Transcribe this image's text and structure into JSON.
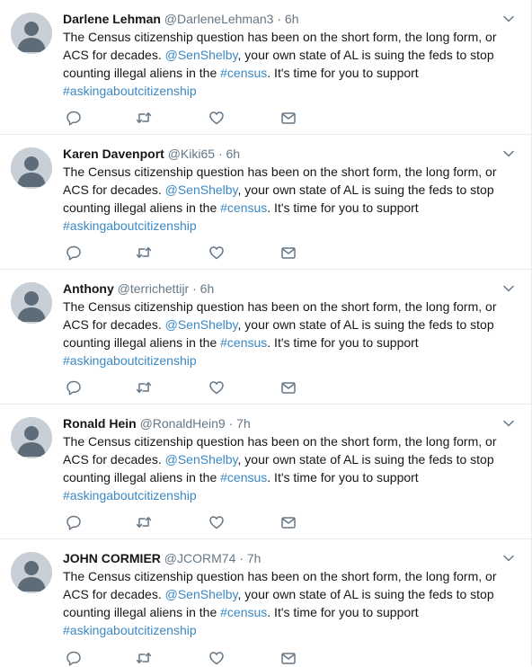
{
  "tweets": [
    {
      "name": "Darlene Lehman",
      "handle": "@DarleneLehman3",
      "sep": "·",
      "time": "6h",
      "text_a": "The Census citizenship question has been on the short form, the long form, or",
      "text_b": "ACS for decades. ",
      "mention": "@SenShelby",
      "text_c": ", your own state of AL is suing the feds to stop",
      "text_d": "counting illegal aliens in the ",
      "hashtag1": "#census",
      "text_e": ". It's time for you to support",
      "hashtag2": "#askingaboutcitizenship"
    },
    {
      "name": "Karen Davenport",
      "handle": "@Kiki65",
      "sep": "·",
      "time": "6h",
      "text_a": "The Census citizenship question has been on the short form, the long form, or",
      "text_b": "ACS for decades. ",
      "mention": "@SenShelby",
      "text_c": ", your own state of AL is suing the feds to stop",
      "text_d": "counting illegal aliens in the ",
      "hashtag1": "#census",
      "text_e": ". It's time for you to support",
      "hashtag2": "#askingaboutcitizenship"
    },
    {
      "name": "Anthony",
      "handle": "@terrichettijr",
      "sep": "·",
      "time": "6h",
      "text_a": "The Census citizenship question has been on the short form, the long form, or",
      "text_b": "ACS for decades. ",
      "mention": "@SenShelby",
      "text_c": ", your own state of AL is suing the feds to stop",
      "text_d": "counting illegal aliens in the ",
      "hashtag1": "#census",
      "text_e": ". It's time for you to support",
      "hashtag2": "#askingaboutcitizenship"
    },
    {
      "name": "Ronald Hein",
      "handle": "@RonaldHein9",
      "sep": "·",
      "time": "7h",
      "text_a": "The Census citizenship question has been on the short form, the long form, or",
      "text_b": "ACS for decades. ",
      "mention": "@SenShelby",
      "text_c": ", your own state of AL is suing the feds to stop",
      "text_d": "counting illegal aliens in the ",
      "hashtag1": "#census",
      "text_e": ". It's time for you to support",
      "hashtag2": "#askingaboutcitizenship"
    },
    {
      "name": "JOHN CORMIER",
      "handle": "@JCORM74",
      "sep": "·",
      "time": "7h",
      "text_a": "The Census citizenship question has been on the short form, the long form, or",
      "text_b": "ACS for decades. ",
      "mention": "@SenShelby",
      "text_c": ", your own state of AL is suing the feds to stop",
      "text_d": "counting illegal aliens in the ",
      "hashtag1": "#census",
      "text_e": ". It's time for you to support",
      "hashtag2": "#askingaboutcitizenship"
    }
  ],
  "colors": {
    "link": "#3b88c3",
    "secondary_text": "#657786",
    "icon": "#657786",
    "avatar_bg": "#c8cfd6",
    "avatar_fg": "#5e6b78"
  },
  "icons": [
    "reply-icon",
    "retweet-icon",
    "like-icon",
    "direct-message-icon",
    "chevron-down-icon",
    "default-avatar-icon"
  ]
}
